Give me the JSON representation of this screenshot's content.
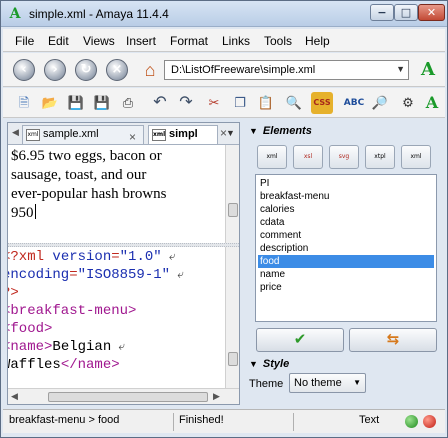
{
  "window": {
    "title": "simple.xml - Amaya 11.4.4",
    "minimize": "−",
    "maximize": "□",
    "close": "✕"
  },
  "menu": [
    "File",
    "Edit",
    "Views",
    "Insert",
    "Format",
    "Links",
    "Tools",
    "Help"
  ],
  "address": {
    "url": "D:\\ListOfFreeware\\simple.xml"
  },
  "tabs": [
    {
      "label": "sample.xml",
      "icon": "xml"
    },
    {
      "label": "simpl",
      "icon": "xml"
    }
  ],
  "formatted_view": {
    "lines": [
      "$6.95 two eggs, bacon or",
      "sausage, toast, and our",
      "ever-popular hash browns",
      "950"
    ]
  },
  "source_view": {
    "lines": [
      [
        {
          "c": "pi",
          "t": "<?xml "
        },
        {
          "c": "attr",
          "t": "version"
        },
        {
          "c": "pi",
          "t": "="
        },
        {
          "c": "val",
          "t": "\"1.0\""
        },
        {
          "c": "wrap",
          "t": " ⤶"
        }
      ],
      [
        {
          "c": "attr",
          "t": "encoding"
        },
        {
          "c": "pi",
          "t": "="
        },
        {
          "c": "val",
          "t": "\"ISO8859-1\""
        },
        {
          "c": "wrap",
          "t": " ⤶"
        }
      ],
      [
        {
          "c": "pi",
          "t": "?>"
        }
      ],
      [
        {
          "c": "tag",
          "t": "<breakfast-menu>"
        }
      ],
      [
        {
          "c": "tag",
          "t": "  <food>"
        }
      ],
      [
        {
          "c": "tag",
          "t": "    <name>"
        },
        {
          "c": "txt",
          "t": "Belgian"
        },
        {
          "c": "wrap",
          "t": " ⤶"
        }
      ],
      [
        {
          "c": "txt",
          "t": "Waffles"
        },
        {
          "c": "tag",
          "t": "</name>"
        }
      ],
      [
        {
          "c": "txt",
          "t": "      "
        }
      ]
    ]
  },
  "panel": {
    "elements_title": "Elements",
    "element_buttons": [
      "xml",
      "xsl",
      "svg",
      "xtpl",
      "xml"
    ],
    "element_list": [
      "PI",
      "breakfast-menu",
      "calories",
      "cdata",
      "comment",
      "description",
      "food",
      "name",
      "price"
    ],
    "selected_element": "food",
    "style_title": "Style",
    "theme_label": "Theme",
    "theme_value": "No theme"
  },
  "status": {
    "path": "breakfast-menu > food",
    "message": "Finished!",
    "mode": "Text"
  },
  "colors": {
    "selection": "#3c8ce6",
    "tag": "#a0178f",
    "pi": "#c0281e",
    "attr": "#1b2fb0"
  }
}
